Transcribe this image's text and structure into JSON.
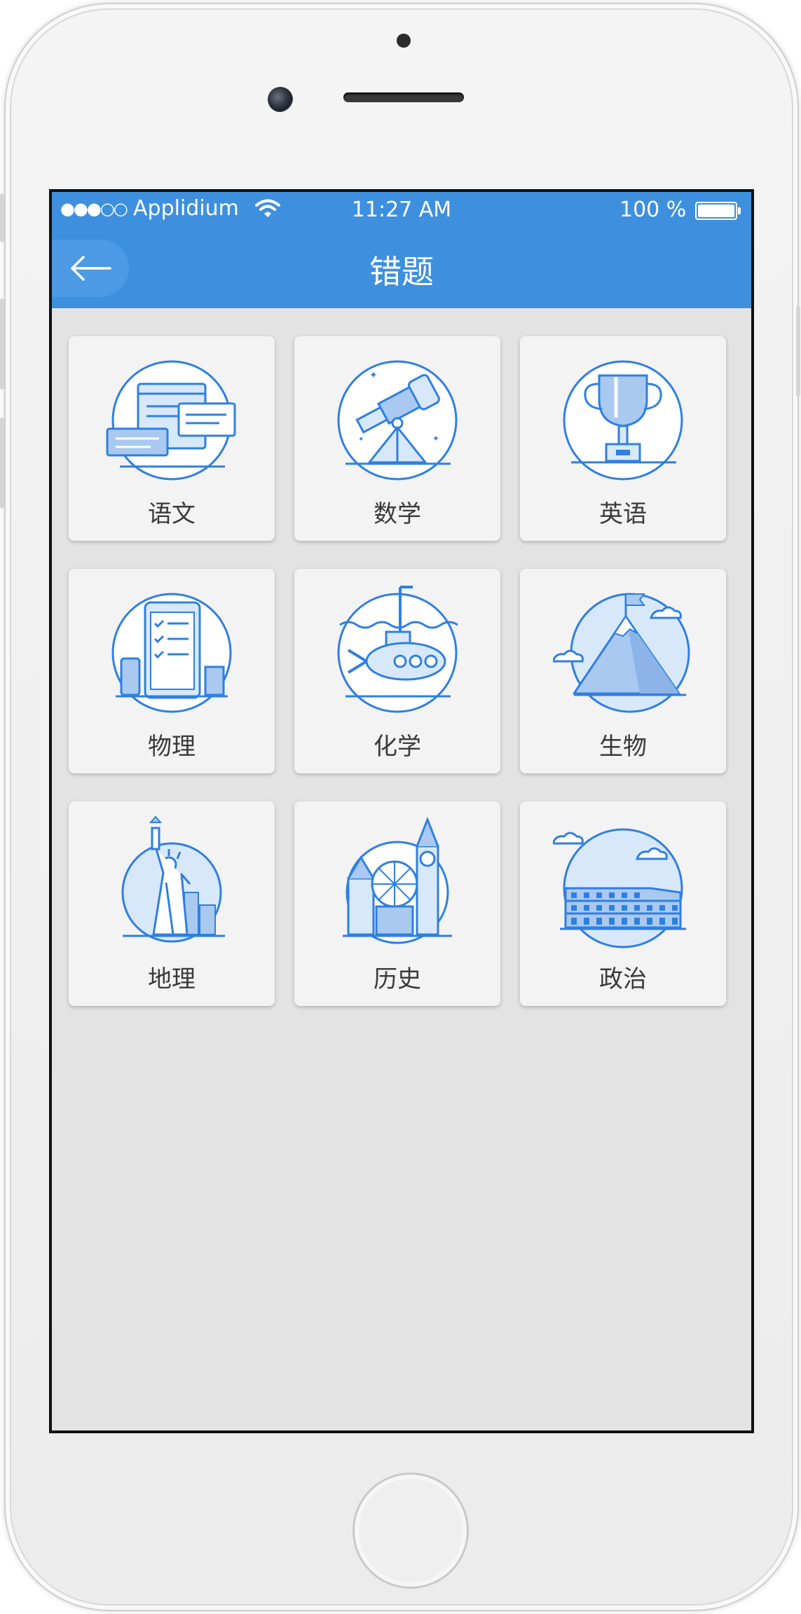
{
  "status_bar": {
    "signal": "●●●○○",
    "carrier": "Applidium",
    "time": "11:27 AM",
    "battery": "100 %"
  },
  "nav": {
    "title": "错题",
    "back_icon": "arrow-left-icon"
  },
  "subjects": [
    {
      "label": "语文",
      "icon": "chat-documents-icon"
    },
    {
      "label": "数学",
      "icon": "telescope-icon"
    },
    {
      "label": "英语",
      "icon": "trophy-icon"
    },
    {
      "label": "物理",
      "icon": "phone-checklist-icon"
    },
    {
      "label": "化学",
      "icon": "submarine-icon"
    },
    {
      "label": "生物",
      "icon": "mountain-flag-icon"
    },
    {
      "label": "地理",
      "icon": "statue-of-liberty-icon"
    },
    {
      "label": "历史",
      "icon": "big-ben-icon"
    },
    {
      "label": "政治",
      "icon": "colosseum-icon"
    }
  ],
  "colors": {
    "accent": "#3e90de",
    "icon_stroke": "#2f7fe0",
    "icon_fill": "#d8e8fb",
    "icon_fill_dark": "#a9c9f1",
    "background": "#e3e3e3",
    "card": "#f3f3f3"
  }
}
